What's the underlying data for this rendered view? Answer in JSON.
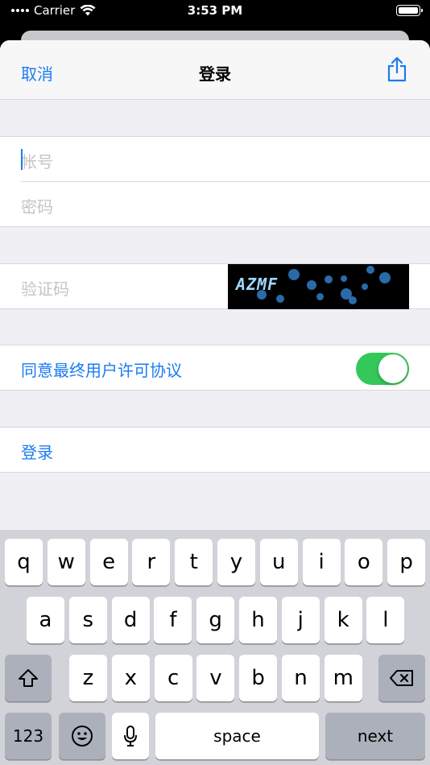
{
  "status_bar": {
    "carrier": "Carrier",
    "time": "3:53 PM"
  },
  "navbar": {
    "cancel": "取消",
    "title": "登录",
    "share_icon": "share-icon"
  },
  "form": {
    "account_placeholder": "帐号",
    "password_placeholder": "密码",
    "captcha_placeholder": "验证码",
    "captcha_text": "AZMF",
    "agree_label": "同意最终用户许可协议",
    "agree_on": true,
    "login_label": "登录"
  },
  "keyboard": {
    "row1": [
      "q",
      "w",
      "e",
      "r",
      "t",
      "y",
      "u",
      "i",
      "o",
      "p"
    ],
    "row2": [
      "a",
      "s",
      "d",
      "f",
      "g",
      "h",
      "j",
      "k",
      "l"
    ],
    "row3": [
      "z",
      "x",
      "c",
      "v",
      "b",
      "n",
      "m"
    ],
    "numbers_key": "123",
    "space_key": "space",
    "next_key": "next"
  },
  "colors": {
    "accent": "#1a7cf2",
    "toggle_on": "#34c759"
  }
}
